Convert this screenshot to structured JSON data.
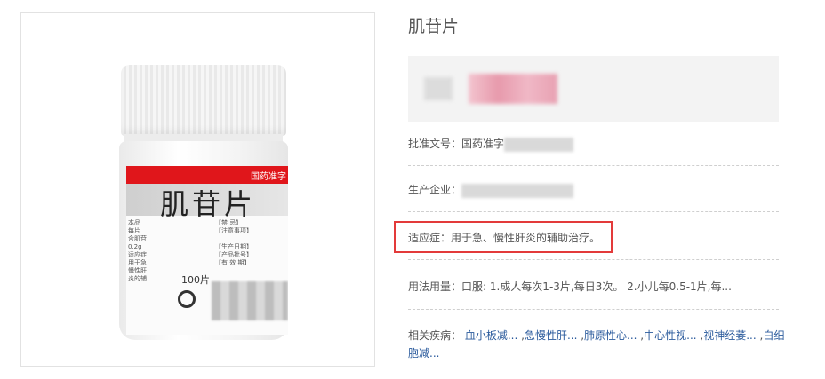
{
  "product": {
    "title": "肌苷片",
    "image": {
      "band_text": "国药准字",
      "name_on_label": "肌苷片",
      "quantity": "100片",
      "fine_text_left": [
        "本品",
        "每片",
        "含肌苷",
        "0.2g",
        "适应症",
        "用于急",
        "慢性肝",
        "炎的辅"
      ],
      "fine_text_mid": [
        "【禁 忌】",
        "【注意事项】",
        "【生产日期】",
        "【产品批号】",
        "【有 效 期】"
      ]
    }
  },
  "info": {
    "approval_label": "批准文号：国药准字",
    "manufacturer_label": "生产企业：",
    "indication": "适应症：用于急、慢性肝炎的辅助治疗。",
    "dosage": "用法用量：口服: 1.成人每次1-3片,每日3次。 2.小儿每0.5-1片,每...",
    "related_label": "相关疾病：",
    "related": [
      "血小板减...",
      "急慢性肝...",
      "肺原性心...",
      "中心性视...",
      "视神经萎...",
      "白细胞减..."
    ]
  },
  "colors": {
    "highlight": "#e33a3a",
    "link": "#2a5a9c",
    "label_red": "#e0161b"
  }
}
